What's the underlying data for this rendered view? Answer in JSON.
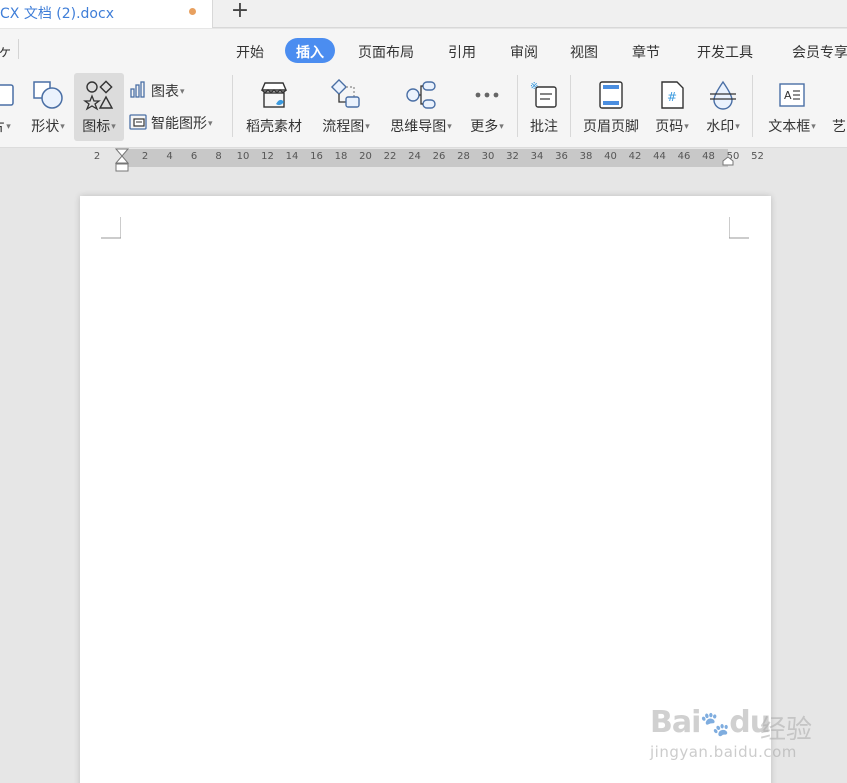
{
  "tab": {
    "title": "CX 文档 (2).docx",
    "new_tab_symbol": "+"
  },
  "menu": {
    "left_stub": "ヶ",
    "items": [
      "开始",
      "插入",
      "页面布局",
      "引用",
      "审阅",
      "视图",
      "章节",
      "开发工具",
      "会员专享"
    ],
    "active": "插入",
    "active_color": "#4b8df0"
  },
  "toolbar": {
    "picture_label": "片",
    "shape_label": "形状",
    "icon_label": "图标",
    "chart_label": "图表",
    "smartart_label": "智能图形",
    "material_label": "稻壳素材",
    "flowchart_label": "流程图",
    "mindmap_label": "思维导图",
    "more_label": "更多",
    "comment_label": "批注",
    "header_footer_label": "页眉页脚",
    "page_number_label": "页码",
    "watermark_label": "水印",
    "textbox_label": "文本框",
    "art_label": "艺"
  },
  "ruler": {
    "left_label": "2",
    "labels": [
      "2",
      "4",
      "6",
      "8",
      "10",
      "12",
      "14",
      "16",
      "18",
      "20",
      "22",
      "24",
      "26",
      "28",
      "30",
      "32",
      "34",
      "36",
      "38",
      "40",
      "42",
      "44",
      "46",
      "48",
      "50",
      "52"
    ]
  },
  "watermark": {
    "logo": "Bai",
    "logo_end": "du",
    "cn": "经验",
    "url": "jingyan.baidu.com"
  }
}
